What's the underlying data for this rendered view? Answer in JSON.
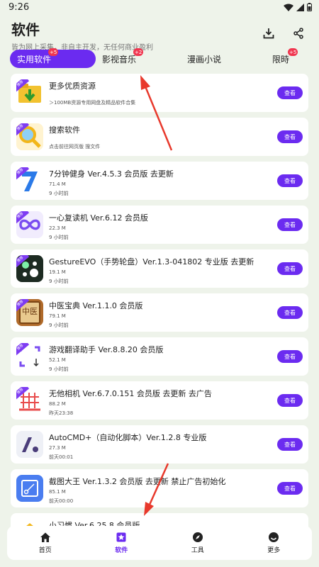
{
  "status": {
    "time": "9:26"
  },
  "header": {
    "title": "软件",
    "subtitle": "皆为网上采集，非自主开发，无任何商业盈利"
  },
  "tabs": [
    {
      "label": "实用软件",
      "badge": "+5"
    },
    {
      "label": "影视音乐",
      "badge": "+2"
    },
    {
      "label": "漫画小说",
      "badge": ""
    },
    {
      "label": "限時",
      "badge": "+5"
    }
  ],
  "view_label": "查看",
  "apps": [
    {
      "name": "更多优质资源",
      "meta1": "＞100MB资源专用网盘及精品软件合集",
      "meta2": ""
    },
    {
      "name": "搜索软件",
      "meta1": "点击前往网页版 搜文件",
      "meta2": ""
    },
    {
      "name": "7分钟健身 Ver.4.5.3 会员版 去更新",
      "meta1": "71.4 M",
      "meta2": "9 小时前"
    },
    {
      "name": "一心复读机 Ver.6.12 会员版",
      "meta1": "22.3 M",
      "meta2": "9 小时前"
    },
    {
      "name": "GestureEVO（手势轮盘）Ver.1.3-041802 专业版 去更新",
      "meta1": "19.1 M",
      "meta2": "9 小时前"
    },
    {
      "name": "中医宝典 Ver.1.1.0 会员版",
      "meta1": "79.1 M",
      "meta2": "9 小时前"
    },
    {
      "name": "游戏翻译助手 Ver.8.8.20 会员版",
      "meta1": "52.1 M",
      "meta2": "9 小时前"
    },
    {
      "name": "无他相机 Ver.6.7.0.151 会员版 去更新 去广告",
      "meta1": "88.2 M",
      "meta2": "昨天23:38"
    },
    {
      "name": "AutoCMD+（自动化脚本）Ver.1.2.8 专业版",
      "meta1": "27.3 M",
      "meta2": "前天00:01"
    },
    {
      "name": "截图大王 Ver.1.3.2 会员版 去更新 禁止广告初始化",
      "meta1": "85.1 M",
      "meta2": "前天00:00"
    },
    {
      "name": "小习惯 Ver.6.25.8 会员版",
      "meta1": "",
      "meta2": ""
    }
  ],
  "icon_tag": "推荐",
  "icon_text": {
    "zhongyi": "中医"
  },
  "nav": [
    {
      "label": "首页",
      "icon": "home-icon"
    },
    {
      "label": "软件",
      "icon": "star-icon"
    },
    {
      "label": "工具",
      "icon": "compass-icon"
    },
    {
      "label": "更多",
      "icon": "smile-icon"
    }
  ],
  "colors": {
    "accent": "#6b2bf0",
    "badge": "#f0364f",
    "background": "#eef3ea",
    "arrow": "#e8392c"
  }
}
